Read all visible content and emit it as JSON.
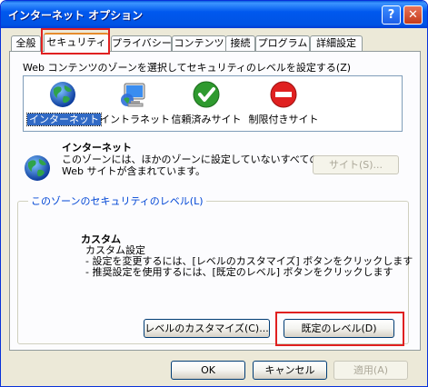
{
  "window": {
    "title": "インターネット オプション"
  },
  "titlebar_buttons": {
    "help": "?",
    "close": "✕"
  },
  "tabs": [
    {
      "label": "全般"
    },
    {
      "label": "セキュリティ"
    },
    {
      "label": "プライバシー"
    },
    {
      "label": "コンテンツ"
    },
    {
      "label": "接続"
    },
    {
      "label": "プログラム"
    },
    {
      "label": "詳細設定"
    }
  ],
  "active_tab": "セキュリティ",
  "zone_prompt": "Web コンテンツのゾーンを選択してセキュリティのレベルを設定する(Z)",
  "zones": [
    {
      "label": "インターネット",
      "icon": "globe-icon"
    },
    {
      "label": "イントラネット",
      "icon": "computer-icon"
    },
    {
      "label": "信頼済みサイト",
      "icon": "checkmark-icon"
    },
    {
      "label": "制限付きサイト",
      "icon": "restricted-icon"
    }
  ],
  "selected_zone": "インターネット",
  "zone_info": {
    "title": "インターネット",
    "desc_lines": [
      "このゾーンには、ほかのゾーンに設定していないすべての",
      "Web サイトが含まれています。"
    ]
  },
  "sites_button": "サイト(S)...",
  "security_level": {
    "legend": "このゾーンのセキュリティのレベル(L)",
    "title": "カスタム",
    "lines": [
      "カスタム設定",
      "- 設定を変更するには、[レベルのカスタマイズ] ボタンをクリックします",
      "- 推奨設定を使用するには、[既定のレベル] ボタンをクリックします"
    ]
  },
  "customize_level_button": "レベルのカスタマイズ(C)...",
  "default_level_button": "既定のレベル(D)",
  "footer": {
    "ok": "OK",
    "cancel": "キャンセル",
    "apply": "適用(A)"
  },
  "colors": {
    "titlebar": "#0058ee",
    "selection": "#316ac5",
    "highlight_box": "#e02020",
    "legend_text": "#0046d5"
  }
}
